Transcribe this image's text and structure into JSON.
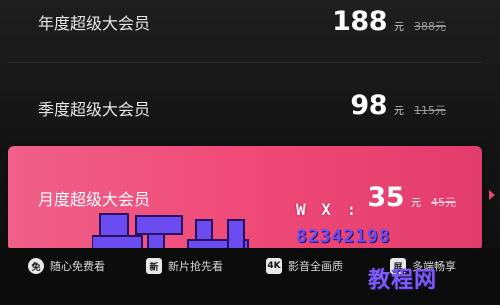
{
  "plans": [
    {
      "name": "年度超级大会员",
      "price": "188",
      "unit": "元",
      "original": "388元"
    },
    {
      "name": "季度超级大会员",
      "price": "98",
      "unit": "元",
      "original": "115元"
    },
    {
      "name": "月度超级大会员",
      "price": "35",
      "unit": "元",
      "original": "45元"
    }
  ],
  "benefits": [
    {
      "icon": "免",
      "label": "随心免费看"
    },
    {
      "icon": "新",
      "label": "新片抢先看"
    },
    {
      "icon": "4K",
      "label": "影音全画质"
    },
    {
      "icon": "屏",
      "label": "多端畅享"
    }
  ],
  "watermark": {
    "wx_label": "W X :",
    "wx_number": "82342198",
    "logo_char": "蜗牛",
    "sub_text": "教程网"
  },
  "colors": {
    "selected_card": "#f04a78",
    "watermark_purple": "#6a4cf0"
  }
}
